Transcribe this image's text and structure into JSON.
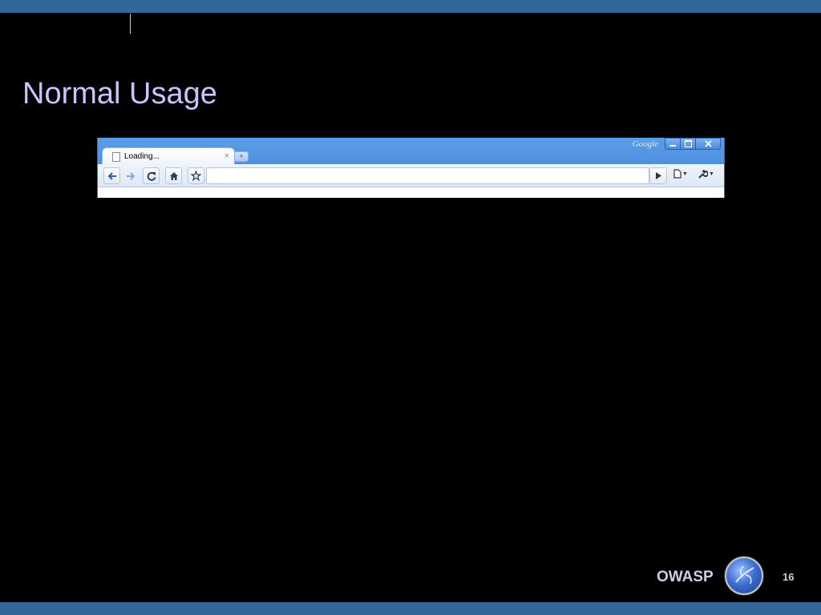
{
  "slide": {
    "title": "Normal Usage",
    "footer_brand": "OWASP",
    "page_number": "16"
  },
  "browser": {
    "brand_text": "Google",
    "tab": {
      "label": "Loading...",
      "close_glyph": "×"
    },
    "new_tab_glyph": "+",
    "toolbar": {
      "back_icon": "back-arrow-icon",
      "forward_icon": "forward-arrow-icon",
      "reload_icon": "reload-icon",
      "home_icon": "home-icon",
      "bookmark_icon": "star-icon",
      "go_icon": "play-icon",
      "page_menu_icon": "page-icon",
      "tools_menu_icon": "wrench-icon"
    },
    "omnibox_value": ""
  },
  "colors": {
    "bars": "#336699",
    "title": "#c6c6ff",
    "browser_frame": "#4a8ddb"
  }
}
